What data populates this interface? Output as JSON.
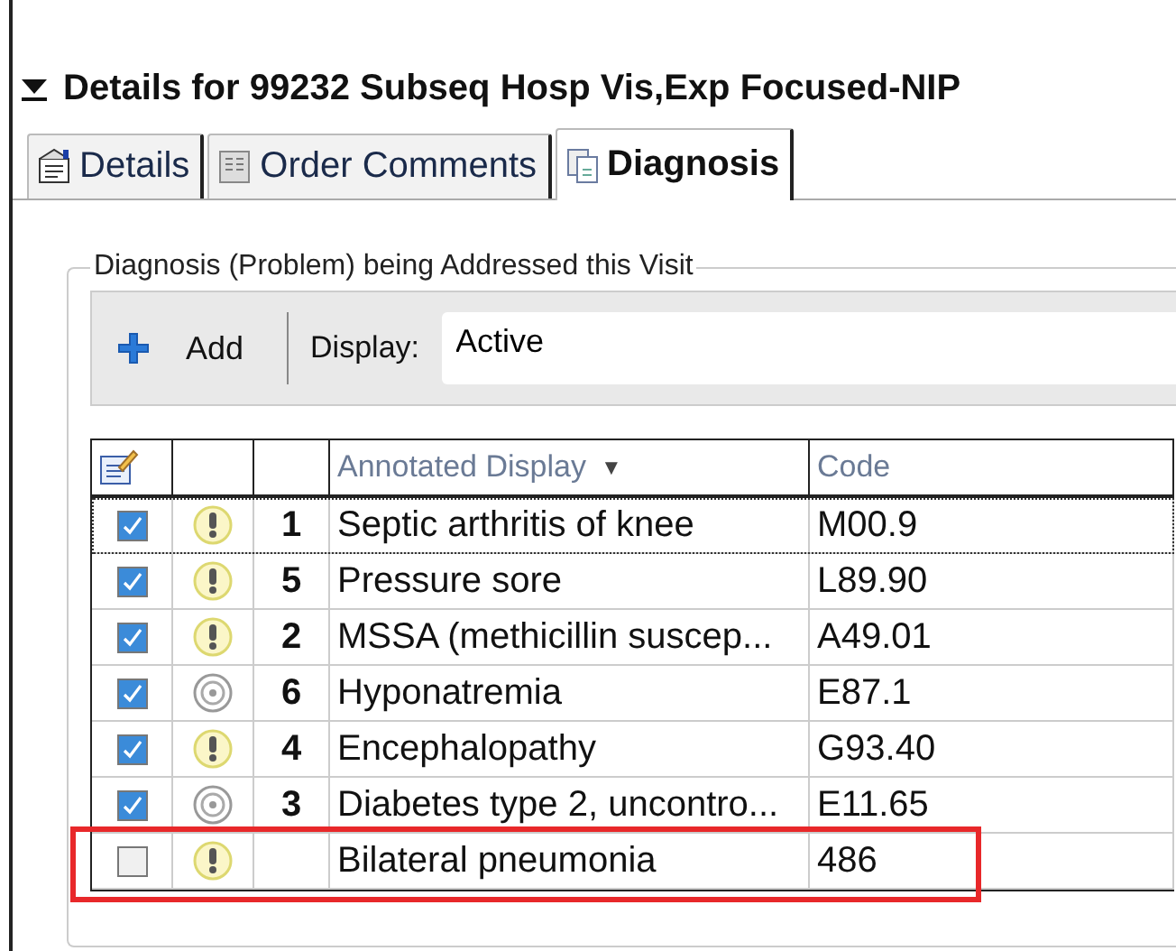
{
  "section": {
    "expanded": true,
    "title": "Details for 99232 Subseq Hosp Vis,Exp Focused-NIP"
  },
  "tabs": [
    {
      "label": "Details",
      "selected": false
    },
    {
      "label": "Order Comments",
      "selected": false
    },
    {
      "label": "Diagnosis",
      "selected": true
    }
  ],
  "group": {
    "legend": "Diagnosis (Problem) being Addressed this Visit",
    "toolbar": {
      "add_label": "Add",
      "display_label": "Display:",
      "display_value": "Active"
    },
    "table": {
      "columns": [
        {
          "label": "Annotated Display",
          "sort_mark": "▼"
        },
        {
          "label": "Code"
        }
      ],
      "rows": [
        {
          "checked": true,
          "kind": "alert",
          "number": "1",
          "display": "Septic arthritis of knee",
          "code": "M00.9",
          "focused": true,
          "highlighted": false
        },
        {
          "checked": true,
          "kind": "alert",
          "number": "5",
          "display": "Pressure sore",
          "code": "L89.90",
          "focused": false,
          "highlighted": false
        },
        {
          "checked": true,
          "kind": "alert",
          "number": "2",
          "display": "MSSA (methicillin suscep...",
          "code": "A49.01",
          "focused": false,
          "highlighted": false
        },
        {
          "checked": true,
          "kind": "target",
          "number": "6",
          "display": "Hyponatremia",
          "code": "E87.1",
          "focused": false,
          "highlighted": false
        },
        {
          "checked": true,
          "kind": "alert",
          "number": "4",
          "display": "Encephalopathy",
          "code": "G93.40",
          "focused": false,
          "highlighted": false
        },
        {
          "checked": true,
          "kind": "target",
          "number": "3",
          "display": "Diabetes type 2, uncontro...",
          "code": "E11.65",
          "focused": false,
          "highlighted": false
        },
        {
          "checked": false,
          "kind": "alert",
          "display": "Bilateral pneumonia",
          "code": "486",
          "focused": false,
          "highlighted": true
        }
      ]
    }
  }
}
